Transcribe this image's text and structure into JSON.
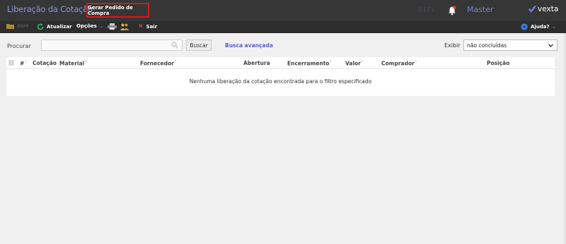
{
  "header": {
    "title": "Liberação da Cotação",
    "generate_button": "Gerar Pedido de Compra",
    "timer": "0.13's",
    "user": "Master",
    "logo_text": "vexta"
  },
  "toolbar": {
    "open": "Abrir",
    "refresh": "Atualizar",
    "options": "Opções",
    "exit": "Sair",
    "help": "Ajuda?"
  },
  "filter": {
    "search_label": "Procurar",
    "search_value": "",
    "search_button": "Buscar",
    "advanced_search": "Busca avançada",
    "show_label": "Exibir",
    "show_value": "não concluídas"
  },
  "table": {
    "columns": [
      "#",
      "Cotação",
      "Material",
      "Fornecedor",
      "Abertura",
      "Encerramento",
      "Valor",
      "Comprador",
      "Posição"
    ],
    "empty_message": "Nenhuma liberação da cotação encontrada para o filtro especificado"
  },
  "colors": {
    "topbar": "#363636",
    "toolbar": "#2d2d2d",
    "accent": "#8f93e0",
    "highlight": "#d21b1b"
  }
}
